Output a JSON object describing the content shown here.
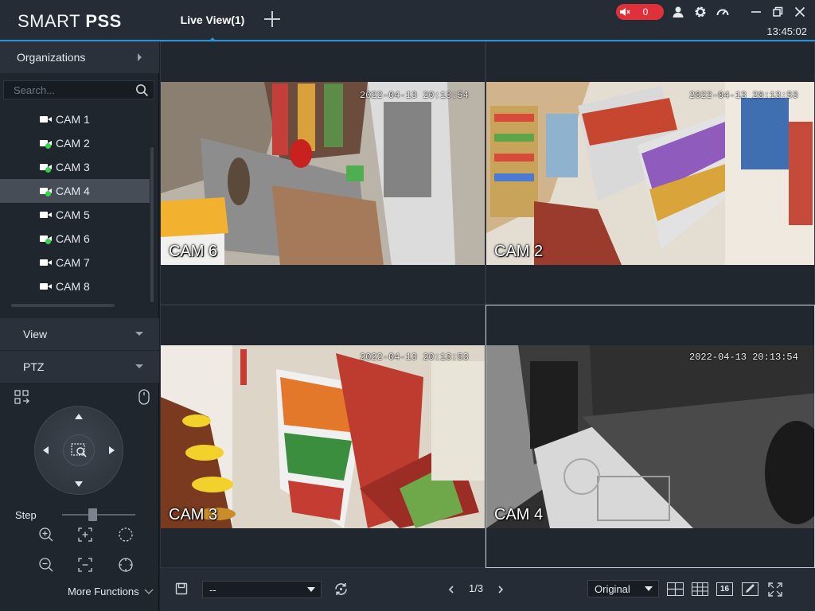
{
  "app": {
    "logo_light": "SMART ",
    "logo_bold": "PSS",
    "clock": "13:45:02"
  },
  "tabs": [
    {
      "label": "Live View(1)"
    }
  ],
  "alarm": {
    "count": "0",
    "color": "#e0303a"
  },
  "colors": {
    "accent": "#2a93d5",
    "online": "#36d24a"
  },
  "sidebar": {
    "organizations": "Organizations",
    "search_placeholder": "Search...",
    "devices": [
      {
        "label": "CAM 1",
        "online": false
      },
      {
        "label": "CAM 2",
        "online": true
      },
      {
        "label": "CAM 3",
        "online": true
      },
      {
        "label": "CAM 4",
        "online": true,
        "selected": true
      },
      {
        "label": "CAM 5",
        "online": false
      },
      {
        "label": "CAM 6",
        "online": true
      },
      {
        "label": "CAM 7",
        "online": false
      },
      {
        "label": "CAM 8",
        "online": false
      }
    ],
    "view": "View",
    "ptz": "PTZ",
    "step_label": "Step",
    "step_level": 0.4,
    "more_functions": "More Functions"
  },
  "tiles": [
    {
      "label": "CAM 6",
      "timestamp": "2022-04-13 20:13:54",
      "scene": "store-counter"
    },
    {
      "label": "CAM 2",
      "timestamp": "2022-04-13 20:13:53",
      "scene": "store-aisle"
    },
    {
      "label": "CAM 3",
      "timestamp": "2022-04-13 20:13:53",
      "scene": "store-shelves"
    },
    {
      "label": "CAM 4",
      "timestamp": "2022-04-13 20:13:54",
      "scene": "night-entrance"
    }
  ],
  "bottombar": {
    "stream_select": "--",
    "page": "1/3",
    "aspect_select": "Original",
    "layout_16": "16"
  }
}
